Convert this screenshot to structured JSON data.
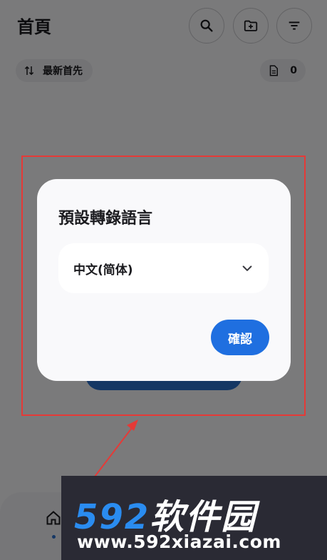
{
  "app": {
    "title": "首頁",
    "sort_label": "最新首先",
    "file_count": "0"
  },
  "dialog": {
    "title": "預設轉錄語言",
    "selected_language": "中文(简体)",
    "confirm_label": "確認"
  },
  "watermark": {
    "logo_digits": "592",
    "logo_text": "软件园",
    "url": "www.592xiazai.com"
  },
  "colors": {
    "accent": "#1f6fe0",
    "annotation": "#e53a37",
    "watermark_blue": "#2a8cf0"
  }
}
